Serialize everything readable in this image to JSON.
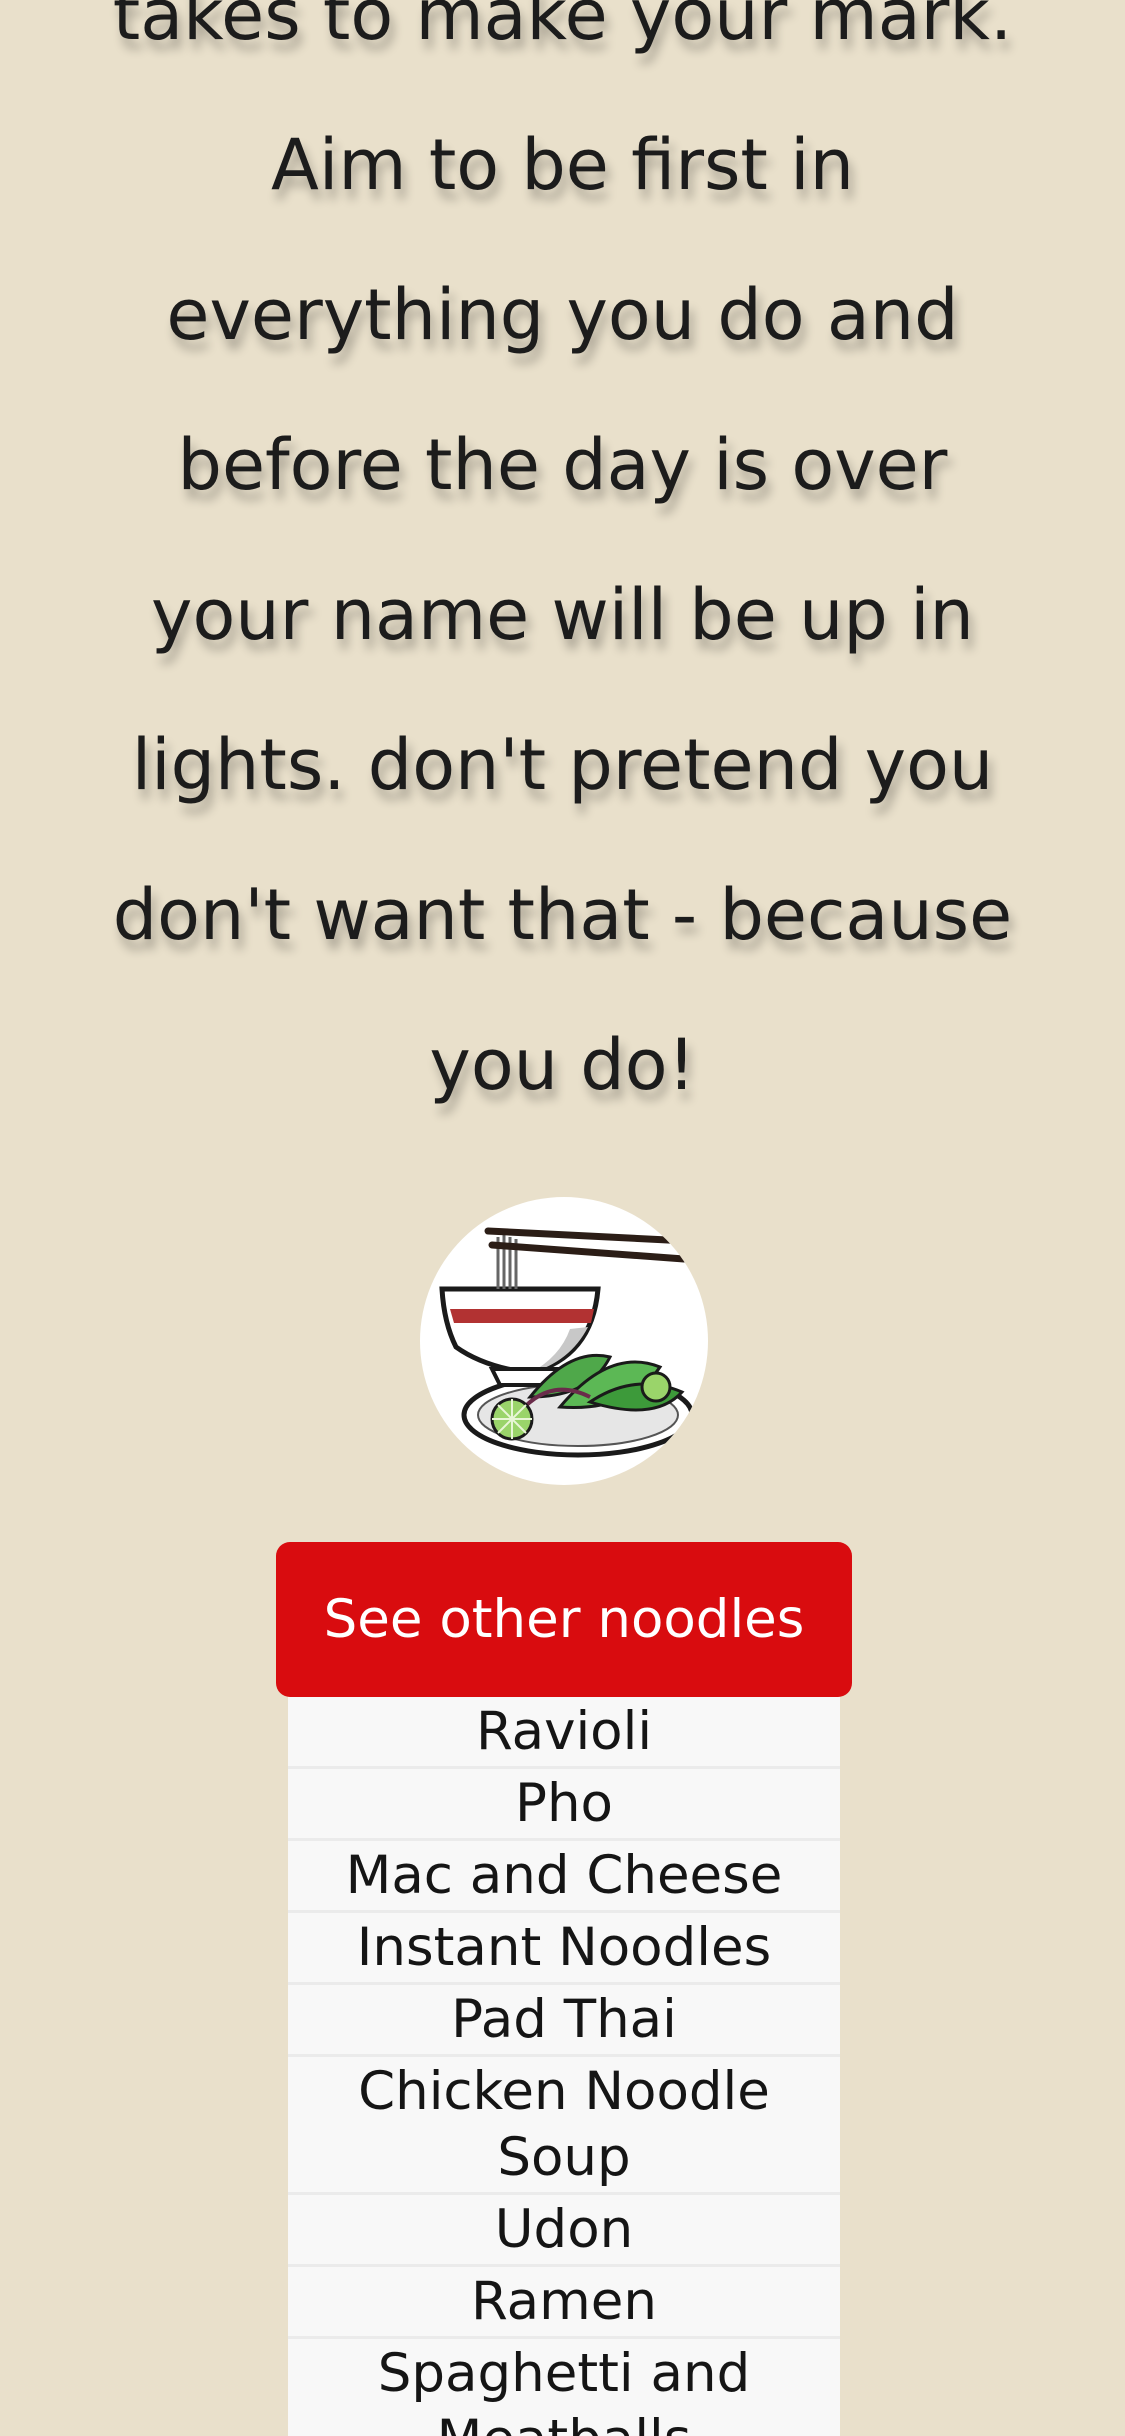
{
  "quote": {
    "lines": [
      "takes to make your mark.",
      "Aim to be first in",
      "everything you do and",
      "before the day is over",
      "your name will be up in",
      "lights. don't pretend you",
      "don't want that - because",
      "you do!"
    ]
  },
  "logo": {
    "icon": "noodle-bowl-icon"
  },
  "dropdown": {
    "button_label": "See other noodles",
    "button_color": "#d90c0f",
    "items": [
      "Ravioli",
      "Pho",
      "Mac and Cheese",
      "Instant Noodles",
      "Pad Thai",
      "Chicken Noodle Soup",
      "Udon",
      "Ramen",
      "Spaghetti and Meatballs"
    ]
  },
  "colors": {
    "background": "#e9e0cb",
    "menu_background": "#f8f8f8"
  }
}
